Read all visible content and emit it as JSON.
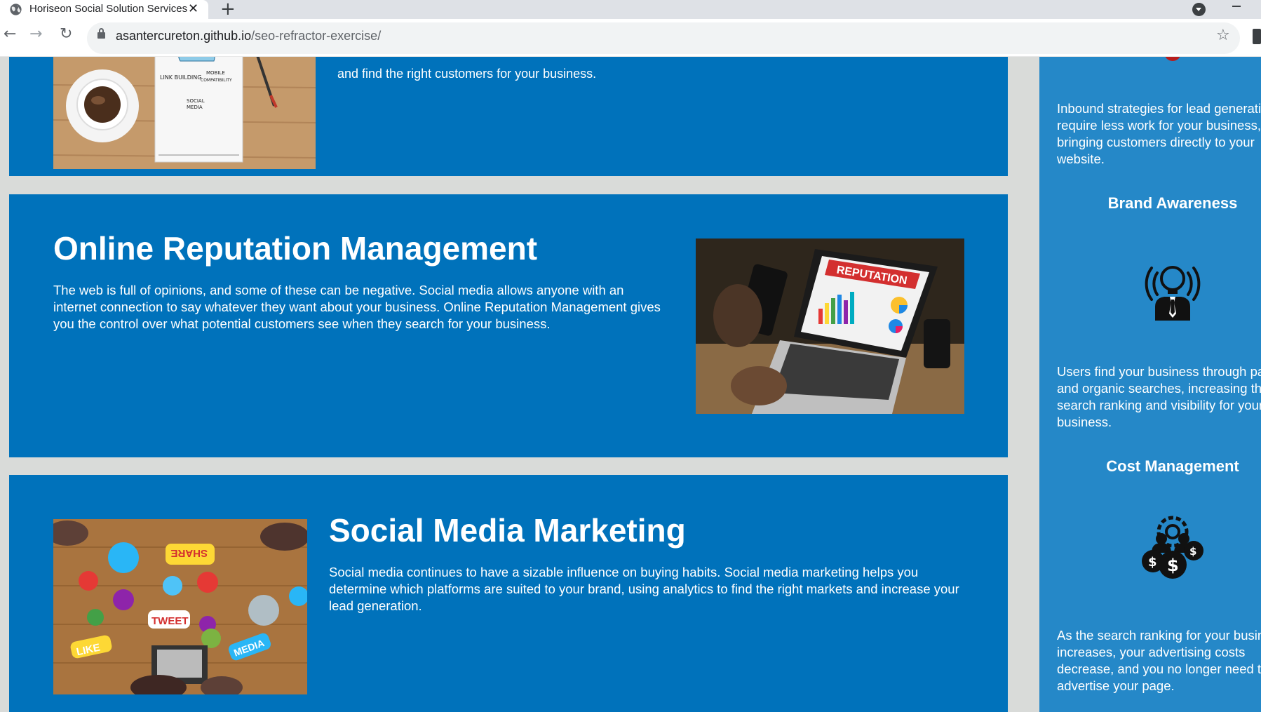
{
  "browser": {
    "tab_title": "Horiseon Social Solution Services",
    "tab_close": "✕",
    "new_tab": "+",
    "url_host": "asantercureton.github.io",
    "url_path": "/seo-refractor-exercise/",
    "back": "←",
    "forward": "→",
    "reload": "↻",
    "star": "☆"
  },
  "seo": {
    "tail_text": "and find the right customers for your business.",
    "image_words": [
      "LINK BUILDING",
      "MOBILE COMPATIBILITY",
      "SOCIAL MEDIA"
    ]
  },
  "orm": {
    "title": "Online Reputation Management",
    "text": "The web is full of opinions, and some of these can be negative. Social media allows anyone with an internet connection to say whatever they want about your business. Online Reputation Management gives you the control over what potential customers see when they search for your business.",
    "image_word": "REPUTATION"
  },
  "smm": {
    "title": "Social Media Marketing",
    "text": "Social media continues to have a sizable influence on buying habits. Social media marketing helps you determine which platforms are suited to your brand, using analytics to find the right markets and increase your lead generation.",
    "image_words": [
      "SHARE",
      "TWEET",
      "LIKE",
      "MEDIA"
    ]
  },
  "benefits": {
    "inbound_text": "Inbound strategies for lead generation require less work for your business, bringing customers directly to your website.",
    "brand_title": "Brand Awareness",
    "brand_icon": "lightbulb-person-icon",
    "brand_text": "Users find your business through paid and organic searches, increasing the search ranking and visibility for your business.",
    "cost_title": "Cost Management",
    "cost_icon": "people-gear-dollar-icon",
    "cost_text": "As the search ranking for your business increases, your advertising costs decrease, and you no longer need to advertise your page."
  },
  "colors": {
    "section_bg": "#0072bb",
    "sidebar_bg": "#2588c8",
    "page_bg": "#d9dbd9"
  }
}
